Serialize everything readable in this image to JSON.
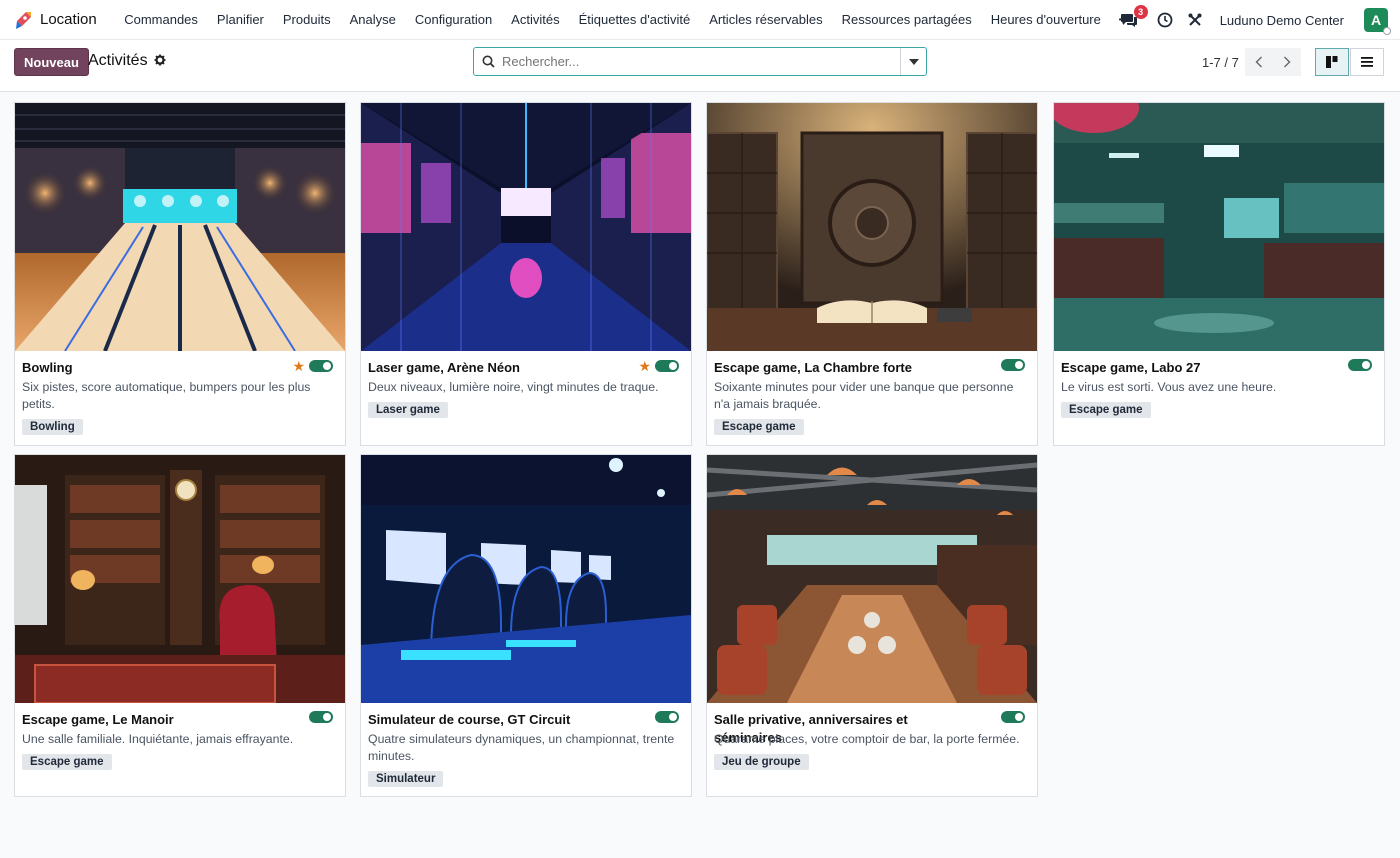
{
  "app": {
    "name": "Location",
    "icon": "rocket-icon"
  },
  "menu": [
    {
      "label": "Commandes"
    },
    {
      "label": "Planifier"
    },
    {
      "label": "Produits"
    },
    {
      "label": "Analyse"
    },
    {
      "label": "Configuration"
    },
    {
      "label": "Activités"
    },
    {
      "label": "Étiquettes d'activité"
    },
    {
      "label": "Articles réservables"
    },
    {
      "label": "Ressources partagées"
    },
    {
      "label": "Heures d'ouverture"
    }
  ],
  "systray": {
    "messages_count": "3",
    "company": "Luduno Demo Center",
    "avatar_letter": "A"
  },
  "control": {
    "new_button": "Nouveau",
    "breadcrumb": "Activités",
    "search_placeholder": "Rechercher...",
    "pager": "1-7 / 7"
  },
  "cards": [
    {
      "title": "Bowling",
      "description": "Six pistes, score automatique, bumpers pour les plus petits.",
      "tag": "Bowling",
      "favorite": true,
      "active": true,
      "image": "bowling"
    },
    {
      "title": "Laser game, Arène Néon",
      "description": "Deux niveaux, lumière noire, vingt minutes de traque.",
      "tag": "Laser game",
      "favorite": true,
      "active": true,
      "image": "laser"
    },
    {
      "title": "Escape game, La Chambre forte",
      "description": "Soixante minutes pour vider une banque que personne n'a jamais braquée.",
      "tag": "Escape game",
      "favorite": false,
      "active": true,
      "image": "vault"
    },
    {
      "title": "Escape game, Labo 27",
      "description": "Le virus est sorti. Vous avez une heure.",
      "tag": "Escape game",
      "favorite": false,
      "active": true,
      "image": "lab"
    },
    {
      "title": "Escape game, Le Manoir",
      "description": "Une salle familiale. Inquiétante, jamais effrayante.",
      "tag": "Escape game",
      "favorite": false,
      "active": true,
      "image": "manor"
    },
    {
      "title": "Simulateur de course, GT Circuit",
      "description": "Quatre simulateurs dynamiques, un championnat, trente minutes.",
      "tag": "Simulateur",
      "favorite": false,
      "active": true,
      "image": "racing"
    },
    {
      "title": "Salle privative, anniversaires et séminaires",
      "description": "Quarante places, votre comptoir de bar, la porte fermée.",
      "tag": "Jeu de groupe",
      "favorite": false,
      "active": true,
      "image": "hall"
    }
  ]
}
